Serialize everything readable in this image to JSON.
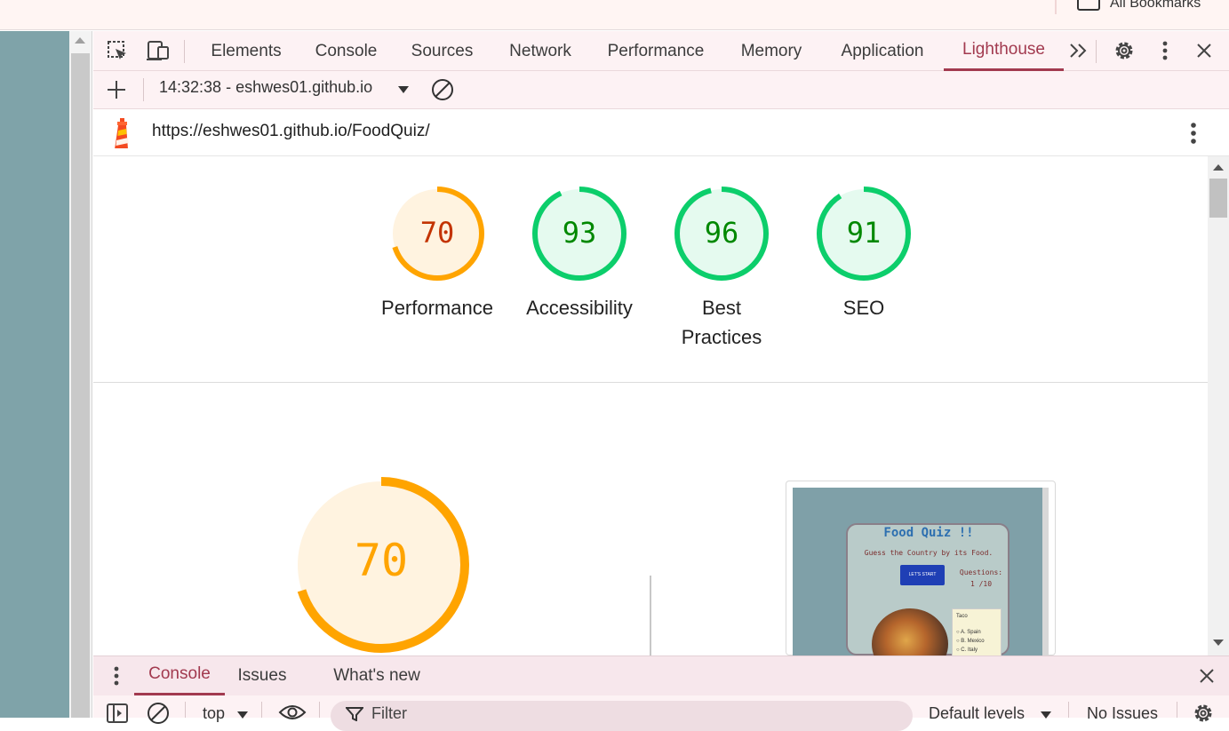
{
  "browser": {
    "bookmarks_label": "All Bookmarks"
  },
  "devtools": {
    "tabs": [
      {
        "label": "Elements"
      },
      {
        "label": "Console"
      },
      {
        "label": "Sources"
      },
      {
        "label": "Network"
      },
      {
        "label": "Performance"
      },
      {
        "label": "Memory"
      },
      {
        "label": "Application"
      },
      {
        "label": "Lighthouse",
        "active": true
      }
    ],
    "icons": [
      "inspect-element-icon",
      "device-toolbar-icon",
      "more-tabs-icon",
      "settings-icon",
      "kebab-menu-icon",
      "close-icon"
    ]
  },
  "lighthouse": {
    "report_selector": "14:32:38 - eshwes01.github.io",
    "url": "https://eshwes01.github.io/FoodQuiz/",
    "scores": [
      {
        "label": "Performance",
        "value": "70",
        "score": 0.7,
        "status": "average"
      },
      {
        "label": "Accessibility",
        "value": "93",
        "score": 0.93,
        "status": "pass"
      },
      {
        "label": "Best Practices",
        "value": "96",
        "score": 0.96,
        "status": "pass"
      },
      {
        "label": "SEO",
        "value": "91",
        "score": 0.91,
        "status": "pass"
      }
    ],
    "main_gauge": {
      "value": "70",
      "score": 0.7
    },
    "colors": {
      "average": "#ffa400",
      "average_text": "#c33300",
      "average_bg": "#fff3e0",
      "pass": "#0cce6b",
      "pass_text": "#008800",
      "pass_bg": "#e5faef",
      "accent": "#a23a4f"
    }
  },
  "screenshot": {
    "title": "Food Quiz !!",
    "subtitle": "Guess the Country by its Food.",
    "start_label": "LET'S START",
    "questions_label": "Questions:",
    "questions_count": "1 /10",
    "food_name": "Taco",
    "answers": [
      "A. Spain",
      "B. Mexico",
      "C. Italy"
    ]
  },
  "drawer": {
    "tabs": [
      {
        "label": "Console",
        "active": true
      },
      {
        "label": "Issues"
      },
      {
        "label": "What's new"
      }
    ],
    "context": "top",
    "filter_placeholder": "Filter",
    "levels": "Default levels",
    "issues": "No Issues"
  }
}
